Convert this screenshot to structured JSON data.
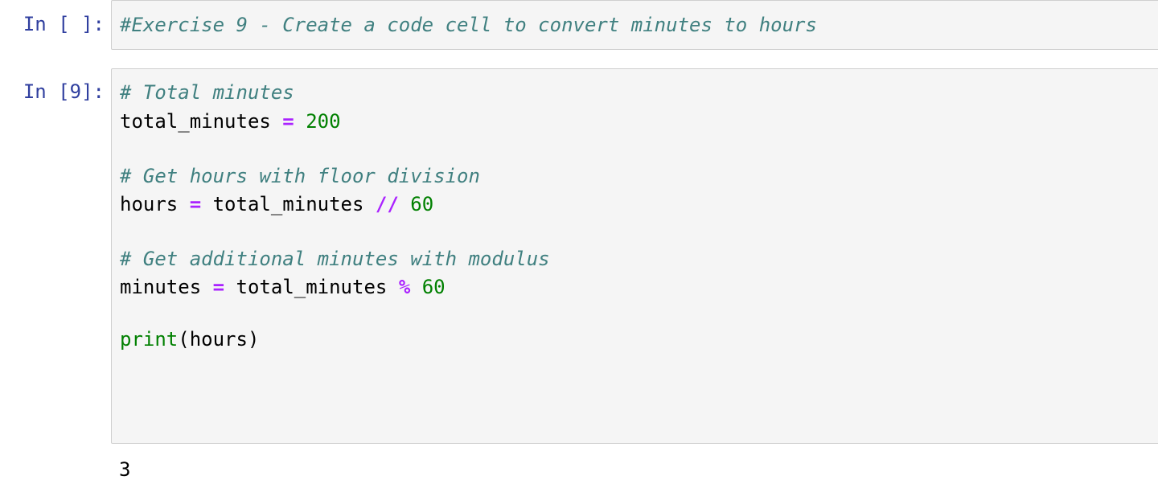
{
  "cells": [
    {
      "prompt": "In [ ]:",
      "lines": [
        {
          "comment": "#Exercise 9 - Create a code cell to convert minutes to hours"
        }
      ]
    },
    {
      "prompt": "In [9]:",
      "lines": [
        {
          "comment": "# Total minutes"
        },
        {
          "name": "total_minutes",
          "op": "=",
          "num": "200"
        },
        {
          "comment": "# Get hours with floor division"
        },
        {
          "name": "hours",
          "op": "=",
          "rhs": "total_minutes",
          "op2": "//",
          "num": "60"
        },
        {
          "comment": "# Get additional minutes with modulus"
        },
        {
          "name": "minutes",
          "op": "=",
          "rhs": "total_minutes",
          "op2": "%",
          "num": "60"
        },
        {
          "builtin": "print",
          "args": "(hours)"
        }
      ],
      "output": "3"
    }
  ]
}
